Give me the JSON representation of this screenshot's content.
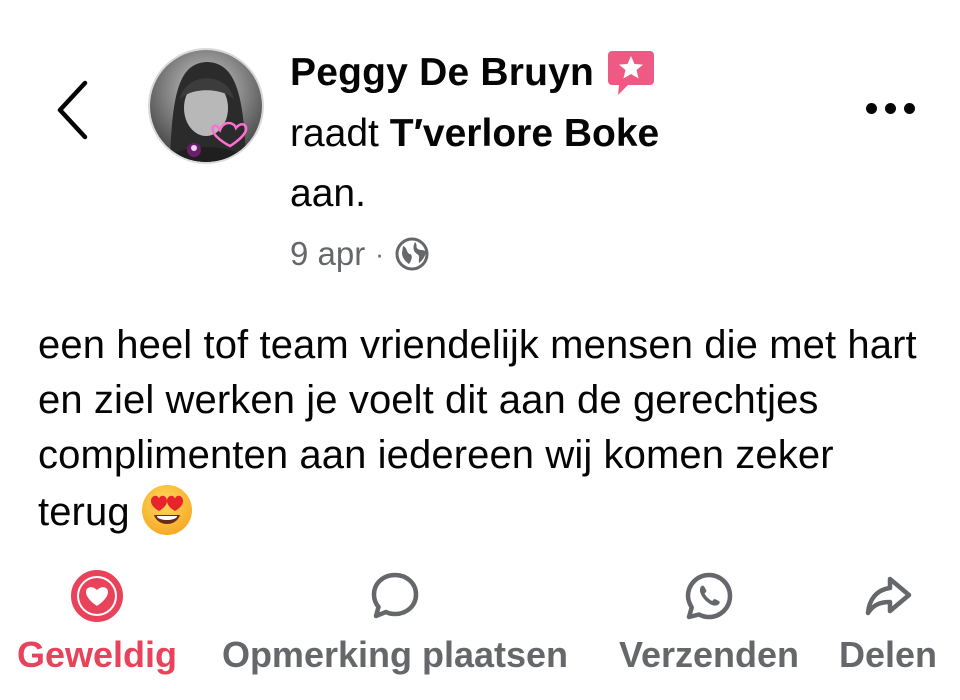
{
  "post": {
    "author": "Peggy De Bruyn",
    "verb": "raadt",
    "page_name": "T′verlore Boke",
    "suffix": "aan.",
    "date": "9 apr",
    "separator": "·",
    "audience_icon": "globe-icon",
    "badge_icon": "star-badge-icon",
    "review_text": "een heel tof team vriendelijk mensen die met hart en ziel werken je voelt dit aan de gerechtjes complimenten aan iedereen wij komen zeker terug",
    "review_emoji": "heart-eyes-emoji"
  },
  "header": {
    "back_icon": "chevron-left-icon",
    "more_icon": "more-horizontal-icon"
  },
  "actions": {
    "like_label": "Geweldig",
    "comment_label": "Opmerking plaatsen",
    "send_label": "Verzenden",
    "share_label": "Delen"
  },
  "colors": {
    "accent_like": "#e8435a",
    "badge": "#ef5a84",
    "secondary_text": "#65676b",
    "primary_text": "#050505"
  }
}
